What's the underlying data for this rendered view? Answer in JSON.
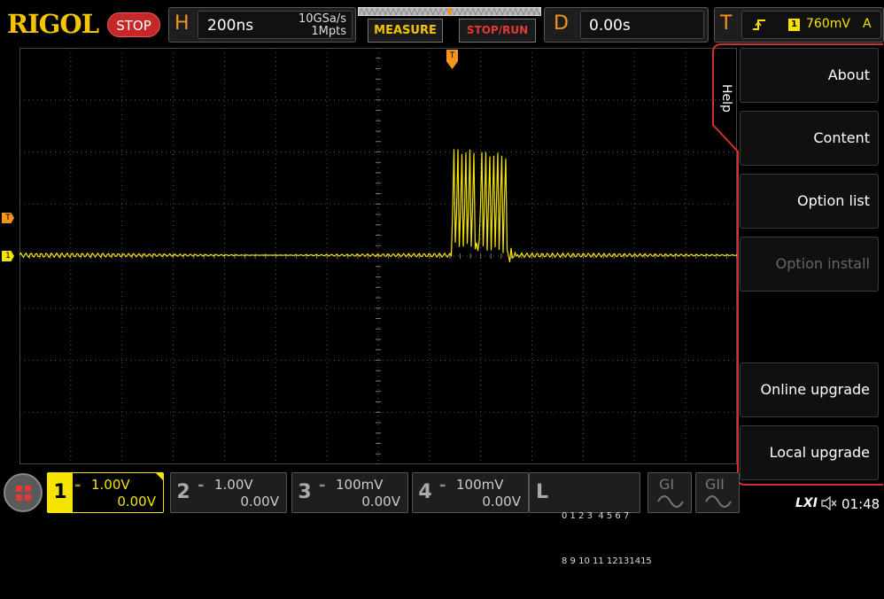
{
  "brand": "RIGOL",
  "run_state": "STOP",
  "horizontal": {
    "letter": "H",
    "timebase": "200ns",
    "sample_rate": "10GSa/s",
    "memory_depth": "1Mpts"
  },
  "buttons": {
    "measure": "MEASURE",
    "stop_run": "STOP/RUN"
  },
  "delay": {
    "letter": "D",
    "value": "0.00s"
  },
  "trigger": {
    "letter": "T",
    "source": "1",
    "level": "760mV",
    "mode": "A"
  },
  "markers": {
    "trigger_level": "T",
    "channel1": "1",
    "trigger_position": "T"
  },
  "help_tab": "Help",
  "menu": [
    {
      "label": "About",
      "enabled": true
    },
    {
      "label": "Content",
      "enabled": true
    },
    {
      "label": "Option list",
      "enabled": true
    },
    {
      "label": "Option install",
      "enabled": false
    },
    {
      "label": "Online upgrade",
      "enabled": true
    },
    {
      "label": "Local upgrade",
      "enabled": true
    }
  ],
  "channels": [
    {
      "num": "1",
      "scale": "1.00V",
      "offset": "0.00V",
      "color": "#f5e400",
      "active": true
    },
    {
      "num": "2",
      "scale": "1.00V",
      "offset": "0.00V",
      "color": "#888888",
      "active": false
    },
    {
      "num": "3",
      "scale": "100mV",
      "offset": "0.00V",
      "color": "#888888",
      "active": false
    },
    {
      "num": "4",
      "scale": "100mV",
      "offset": "0.00V",
      "color": "#888888",
      "active": false
    }
  ],
  "logic": {
    "letter": "L",
    "row1": "0 1 2 3  4 5 6 7",
    "row2": "8 9 10 11 12131415"
  },
  "generators": [
    "GI",
    "GII"
  ],
  "status": {
    "lxi": "LXI",
    "time": "01:48"
  },
  "colors": {
    "accent_orange": "#f7941d",
    "channel1_yellow": "#f5e400",
    "alert_red": "#d32f2f",
    "brand_yellow": "#f5c400"
  }
}
